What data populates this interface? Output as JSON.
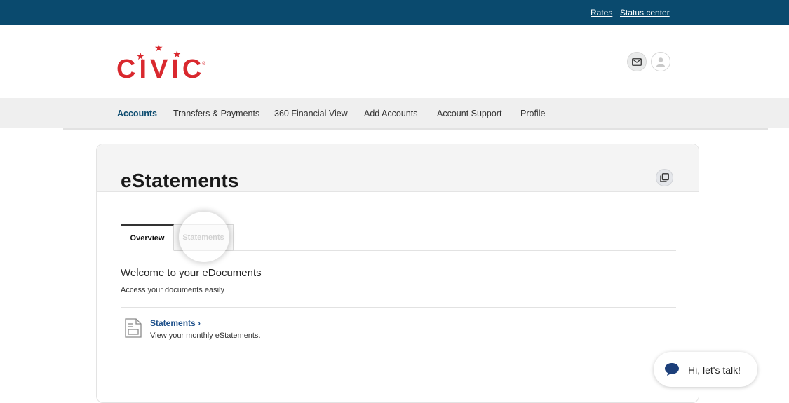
{
  "topbar": {
    "links": [
      "Rates",
      "Status center"
    ],
    "bg_color": "#0a4a6e"
  },
  "brand": {
    "logo_text": "CIVIC",
    "registered_mark": "®",
    "color": "#d9282e"
  },
  "header_icons": [
    "mail-icon",
    "user-icon"
  ],
  "nav": {
    "items": [
      "Accounts",
      "Transfers & Payments",
      "360 Financial View",
      "Add Accounts",
      "Account Support",
      "Profile"
    ],
    "active": "Accounts"
  },
  "page": {
    "title": "eStatements"
  },
  "tabs": [
    {
      "label": "Overview",
      "active": true
    },
    {
      "label": "Statements",
      "active": false
    }
  ],
  "overview": {
    "heading": "Welcome to your eDocuments",
    "subheading": "Access your documents easily",
    "items": [
      {
        "title": "Statements",
        "chevron": "›",
        "description": "View your monthly eStatements."
      }
    ]
  },
  "chat": {
    "label": "Hi, let's talk!",
    "icon": "chat-bubble-icon"
  }
}
